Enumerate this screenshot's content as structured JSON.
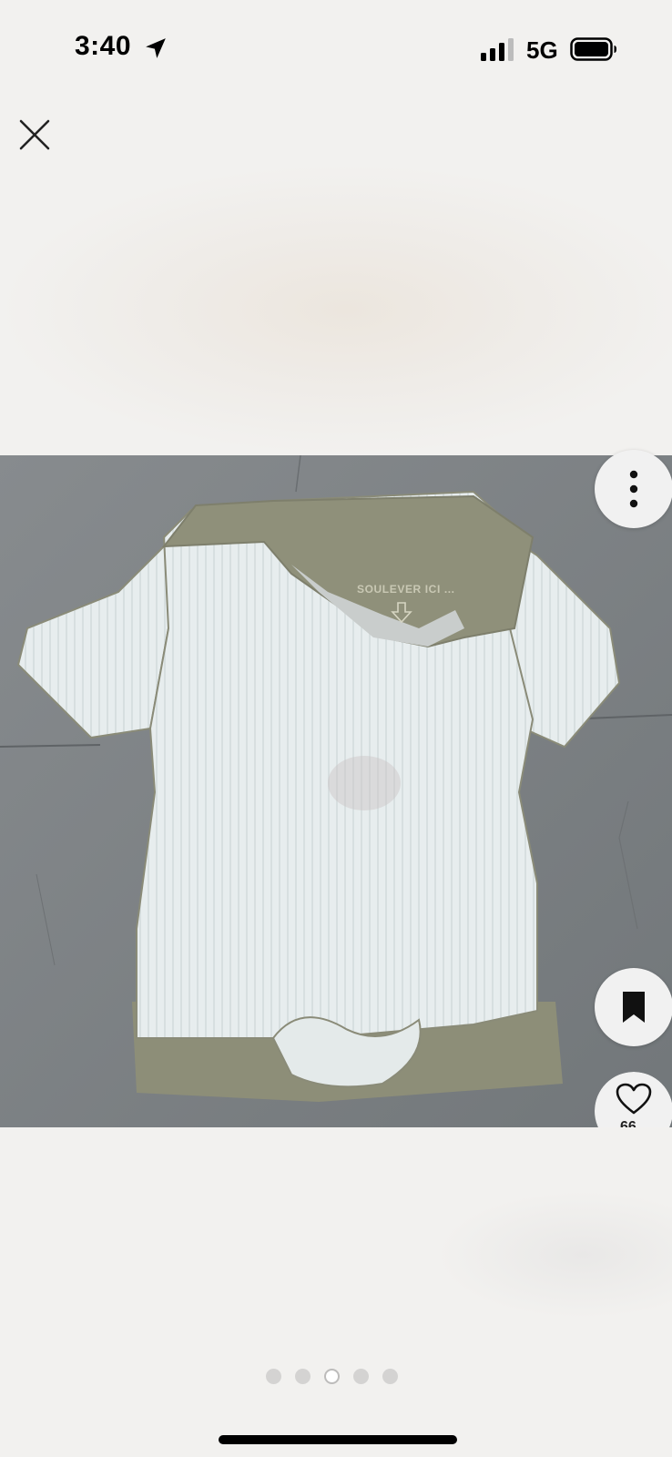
{
  "status_bar": {
    "time": "3:40",
    "network": "5G",
    "icons": [
      "location-arrow-icon",
      "signal-bars-icon",
      "battery-icon"
    ]
  },
  "toolbar": {
    "close_icon": "close-icon",
    "more_icon": "more-vertical-icon",
    "save_icon": "bookmark-icon",
    "like_icon": "heart-icon",
    "like_count": "66"
  },
  "photo": {
    "description_icon": "photo",
    "garment_print": "SOULEVER ICI ..."
  },
  "pagination": {
    "total": 5,
    "active_index": 2
  },
  "colors": {
    "background": "#f2f1ef",
    "floor": "#7c8083",
    "shirt": "#e6ecec",
    "lining": "#8d8e78",
    "active_dot": "#ffffff",
    "inactive_dot": "#d4d3d2"
  }
}
